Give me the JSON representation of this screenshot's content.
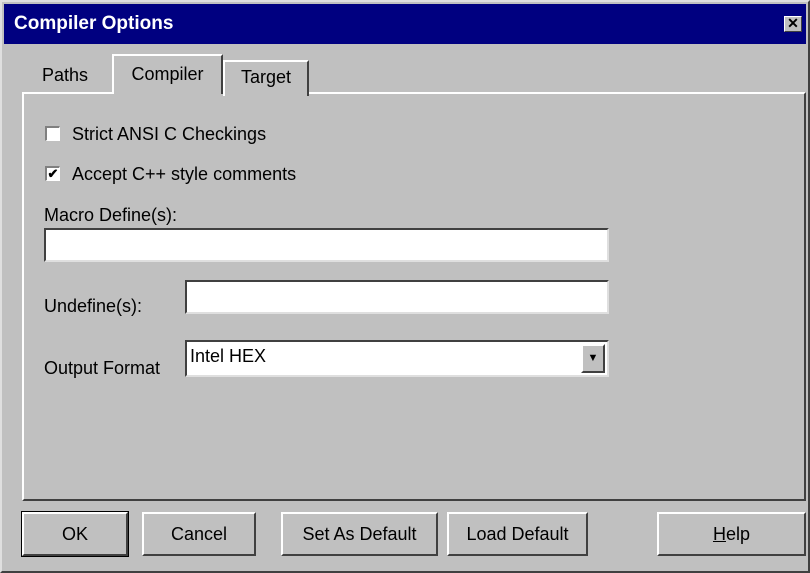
{
  "window": {
    "title": "Compiler Options",
    "close_glyph": "✕"
  },
  "tabs": [
    {
      "label": "Paths",
      "active": false
    },
    {
      "label": "Compiler",
      "active": true
    },
    {
      "label": "Target",
      "active": false
    }
  ],
  "compiler": {
    "strict_ansi": {
      "label": "Strict ANSI C Checkings",
      "checked": false
    },
    "cpp_comments": {
      "label": "Accept C++ style comments",
      "checked": true,
      "glyph": "✔"
    },
    "macro_define": {
      "label": "Macro Define(s):",
      "value": ""
    },
    "undefine": {
      "label": "Undefine(s):",
      "value": ""
    },
    "output_format": {
      "label": "Output Format",
      "value": "Intel HEX",
      "arrow_glyph": "▼"
    }
  },
  "buttons": {
    "ok": "OK",
    "cancel": "Cancel",
    "set_default": "Set As Default",
    "load_default": "Load Default",
    "help_accel": "H",
    "help_rest": "elp"
  }
}
